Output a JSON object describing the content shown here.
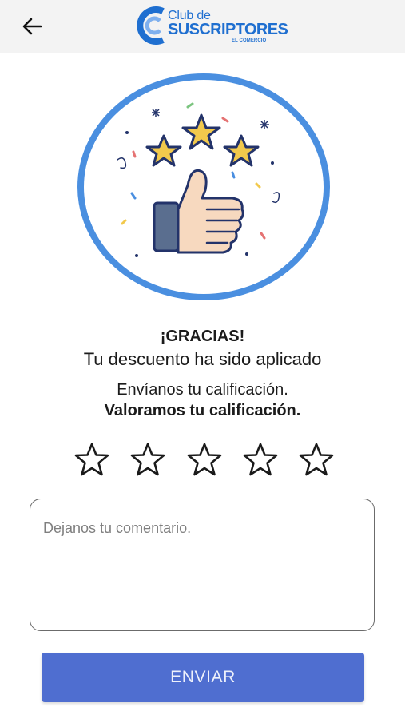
{
  "header": {
    "back_icon": "arrow-left-icon",
    "logo": {
      "line1": "Club de",
      "line2": "SUSCRIPTORES",
      "line3": "EL COMERCIO"
    }
  },
  "illustration": {
    "name": "thumbs-up-stars-illustration"
  },
  "message": {
    "title": "¡GRACIAS!",
    "subtitle": "Tu descuento ha sido aplicado",
    "prompt": "Envíanos tu calificación.",
    "emphasis": "Valoramos tu calificación."
  },
  "rating": {
    "max": 5,
    "value": 0,
    "icon": "star-outline-icon"
  },
  "comment": {
    "placeholder": "Dejanos tu comentario.",
    "value": ""
  },
  "submit": {
    "label": "ENVIAR"
  },
  "colors": {
    "accent": "#4f6ed0",
    "brand": "#1f6fd0",
    "circle": "#4a8fe0",
    "gold_star": "#f2c94c",
    "header_bg": "#f3f3f3"
  }
}
